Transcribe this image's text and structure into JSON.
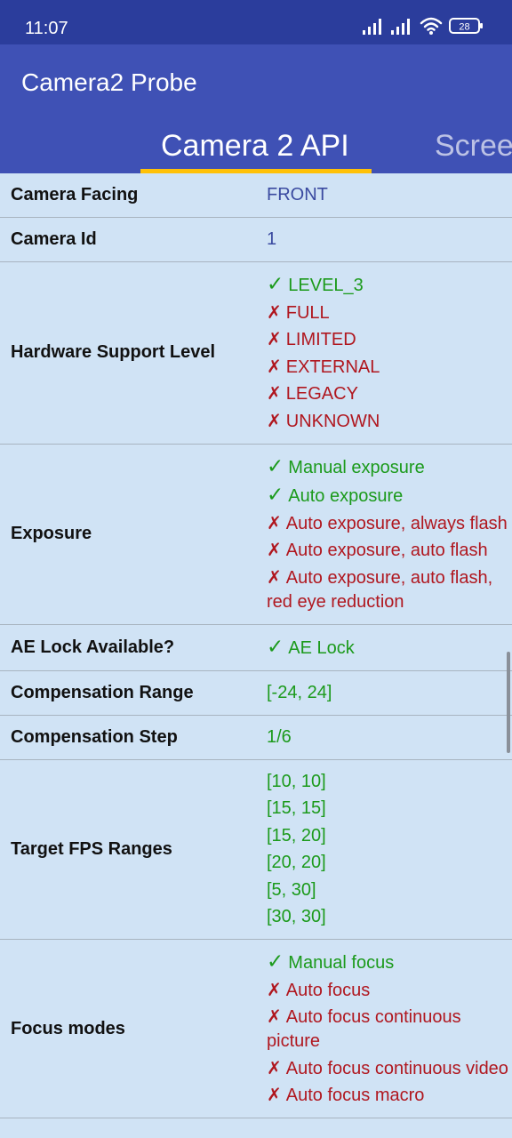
{
  "status_bar": {
    "time": "11:07",
    "battery_level": "28",
    "icons": [
      "signal-icon",
      "signal-icon",
      "wifi-icon",
      "battery-icon"
    ]
  },
  "app_bar": {
    "title": "Camera2 Probe"
  },
  "tabs": [
    {
      "label": "Camera 2 API",
      "selected": true
    },
    {
      "label": "Scree",
      "selected": false
    }
  ],
  "colors": {
    "status_bar": "#2b3d9c",
    "app_bar": "#3f51b5",
    "tab_indicator": "#ffc107",
    "background": "#d0e3f5",
    "supported": "#1b9a1b",
    "unsupported": "#b0171f",
    "neutral_value": "#3a4aa0"
  },
  "rows": [
    {
      "label": "Camera Facing",
      "values": [
        {
          "text": "FRONT",
          "mark": "",
          "status": "neutral"
        }
      ]
    },
    {
      "label": "Camera Id",
      "values": [
        {
          "text": "1",
          "mark": "",
          "status": "neutral"
        }
      ]
    },
    {
      "label": "Hardware Support Level",
      "values": [
        {
          "text": "LEVEL_3",
          "mark": "✓",
          "status": "ok"
        },
        {
          "text": "FULL",
          "mark": "✗",
          "status": "no"
        },
        {
          "text": "LIMITED",
          "mark": "✗",
          "status": "no"
        },
        {
          "text": "EXTERNAL",
          "mark": "✗",
          "status": "no"
        },
        {
          "text": "LEGACY",
          "mark": "✗",
          "status": "no"
        },
        {
          "text": "UNKNOWN",
          "mark": "✗",
          "status": "no"
        }
      ]
    },
    {
      "label": "Exposure",
      "values": [
        {
          "text": "Manual exposure",
          "mark": "✓",
          "status": "ok"
        },
        {
          "text": "Auto exposure",
          "mark": "✓",
          "status": "ok"
        },
        {
          "text": "Auto exposure, always flash",
          "mark": "✗",
          "status": "no"
        },
        {
          "text": "Auto exposure, auto flash",
          "mark": "✗",
          "status": "no"
        },
        {
          "text": "Auto exposure, auto flash, red eye reduction",
          "mark": "✗",
          "status": "no"
        }
      ]
    },
    {
      "label": "AE Lock Available?",
      "values": [
        {
          "text": "AE Lock",
          "mark": "✓",
          "status": "ok"
        }
      ]
    },
    {
      "label": "Compensation Range",
      "values": [
        {
          "text": "[-24, 24]",
          "mark": "",
          "status": "ok"
        }
      ]
    },
    {
      "label": "Compensation Step",
      "values": [
        {
          "text": "1/6",
          "mark": "",
          "status": "ok"
        }
      ]
    },
    {
      "label": "Target FPS Ranges",
      "values": [
        {
          "text": "[10, 10]",
          "mark": "",
          "status": "ok"
        },
        {
          "text": "[15, 15]",
          "mark": "",
          "status": "ok"
        },
        {
          "text": "[15, 20]",
          "mark": "",
          "status": "ok"
        },
        {
          "text": "[20, 20]",
          "mark": "",
          "status": "ok"
        },
        {
          "text": "[5, 30]",
          "mark": "",
          "status": "ok"
        },
        {
          "text": "[30, 30]",
          "mark": "",
          "status": "ok"
        }
      ]
    },
    {
      "label": "Focus modes",
      "values": [
        {
          "text": "Manual focus",
          "mark": "✓",
          "status": "ok"
        },
        {
          "text": "Auto focus",
          "mark": "✗",
          "status": "no"
        },
        {
          "text": "Auto focus continuous picture",
          "mark": "✗",
          "status": "no"
        },
        {
          "text": "Auto focus continuous video",
          "mark": "✗",
          "status": "no"
        },
        {
          "text": "Auto focus macro",
          "mark": "✗",
          "status": "no"
        }
      ]
    }
  ]
}
